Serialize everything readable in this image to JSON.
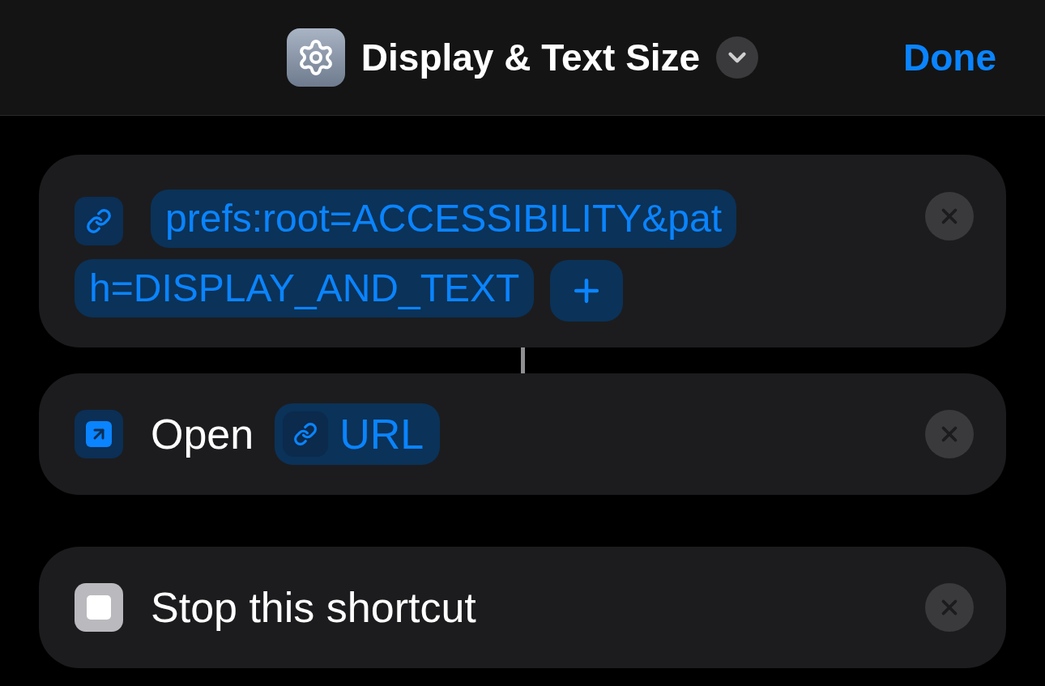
{
  "header": {
    "title": "Display & Text Size",
    "done": "Done"
  },
  "actions": [
    {
      "kind": "url",
      "value_lines": [
        "prefs:root=ACCESSIBILITY&pat",
        "h=DISPLAY_AND_TEXT"
      ],
      "connected": true
    },
    {
      "kind": "open",
      "label": "Open",
      "variable": "URL"
    },
    {
      "kind": "stop",
      "label": "Stop this shortcut"
    }
  ]
}
